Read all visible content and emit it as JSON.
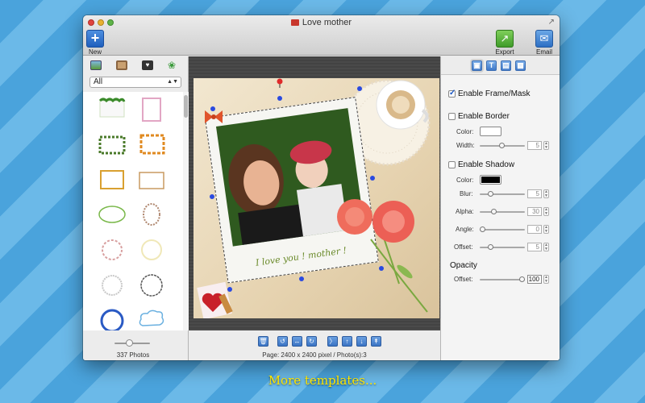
{
  "window": {
    "title": "Love mother"
  },
  "toolbar": {
    "new_label": "New",
    "export_label": "Export",
    "email_label": "Email"
  },
  "left_panel": {
    "filter_value": "All",
    "photo_count": "337 Photos",
    "thumbnail_size_level": 0.33
  },
  "canvas": {
    "caption_text": "I love you ! mother !",
    "page_info": "Page: 2400 x 2400 pixel / Photo(s):3"
  },
  "right_panel": {
    "enable_frame_label": "Enable Frame/Mask",
    "enable_frame_checked": true,
    "enable_border_label": "Enable Border",
    "enable_border_checked": false,
    "border_color_label": "Color:",
    "border_color": "#ffffff",
    "border_width_label": "Width:",
    "border_width_value": "5",
    "enable_shadow_label": "Enable Shadow",
    "enable_shadow_checked": false,
    "shadow_color_label": "Color:",
    "shadow_color": "#000000",
    "blur_label": "Blur:",
    "blur_value": "5",
    "alpha_label": "Alpha:",
    "alpha_value": "30",
    "angle_label": "Angle:",
    "angle_value": "0",
    "offset_label": "Offset:",
    "offset_value": "5",
    "opacity_heading": "Opacity",
    "opacity_offset_label": "Offset:",
    "opacity_value": "100"
  },
  "promo_caption": "More templates...",
  "colors": {
    "accent": "#3b74c4",
    "background_stripe_a": "#4aa3dc",
    "background_stripe_b": "#6bb9e8",
    "caption": "#ffe600"
  }
}
